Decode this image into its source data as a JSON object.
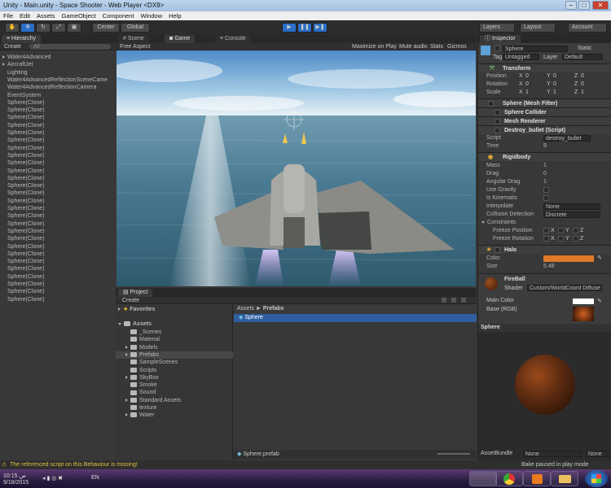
{
  "window": {
    "title": "Unity - Main.unity - Space Shooter - Web Player <DX9>",
    "min": "–",
    "max": "□",
    "close": "✕"
  },
  "menu": [
    "File",
    "Edit",
    "Assets",
    "GameObject",
    "Component",
    "Window",
    "Help"
  ],
  "toolbar": {
    "center": "Center",
    "global": "Global",
    "layers": "Layers",
    "layout": "Layout",
    "account": "Account"
  },
  "hierarchy": {
    "tab": "Hierarchy",
    "create": "Create",
    "search_placeholder": "All",
    "items": [
      "Water4Advanced",
      "AircraftJet",
      "Lighting",
      "Water4AdvancedReflectionSceneCame",
      "Water4AdvancedReflectionCamera",
      "EventSystem",
      "Sphere(Clone)",
      "Sphere(Clone)",
      "Sphere(Clone)",
      "Sphere(Clone)",
      "Sphere(Clone)",
      "Sphere(Clone)",
      "Sphere(Clone)",
      "Sphere(Clone)",
      "Sphere(Clone)",
      "Sphere(Clone)",
      "Sphere(Clone)",
      "Sphere(Clone)",
      "Sphere(Clone)",
      "Sphere(Clone)",
      "Sphere(Clone)",
      "Sphere(Clone)",
      "Sphere(Clone)",
      "Sphere(Clone)",
      "Sphere(Clone)",
      "Sphere(Clone)",
      "Sphere(Clone)",
      "Sphere(Clone)",
      "Sphere(Clone)",
      "Sphere(Clone)",
      "Sphere(Clone)",
      "Sphere(Clone)",
      "Sphere(Clone)"
    ]
  },
  "game": {
    "tabs": [
      "Scene",
      "Game",
      "Console"
    ],
    "aspect": "Free Aspect",
    "maximize": "Maximize on Play",
    "mute": "Mute audio",
    "stats": "Stats",
    "gizmos": "Gizmos"
  },
  "project": {
    "tab": "Project",
    "create": "Create",
    "favorites": "Favorites",
    "assets": "Assets",
    "folders": [
      "_Scenes",
      "Material",
      "Models",
      "Prefabs",
      "SampleScenes",
      "Scripts",
      "SkyBox",
      "Smoke",
      "Sound",
      "Standard Assets",
      "texture",
      "Water"
    ],
    "breadcrumb_root": "Assets",
    "breadcrumb_sep": "►",
    "breadcrumb_leaf": "Prefabs",
    "files": [
      "Sphere"
    ],
    "selected_path": "Sphere.prefab"
  },
  "inspector": {
    "tab": "Inspector",
    "name": "Sphere",
    "static": "Static",
    "tag_label": "Tag",
    "tag": "Untagged",
    "layer_label": "Layer",
    "layer": "Default",
    "transform": "Transform",
    "position": "Position",
    "rotation": "Rotation",
    "scale": "Scale",
    "pos": [
      "0",
      "0",
      "0"
    ],
    "rot": [
      "0",
      "0",
      "0"
    ],
    "scl": [
      "1",
      "1",
      "1"
    ],
    "mesh_filter": "Sphere (Mesh Filter)",
    "sphere_collider": "Sphere Collider",
    "mesh_renderer": "Mesh Renderer",
    "script_comp": "Destroy_bullet (Script)",
    "script_label": "Script",
    "script_value": "destroy_bullet",
    "time_label": "Time",
    "time_value": "5",
    "rigidbody": "Rigidbody",
    "mass_label": "Mass",
    "mass": "1",
    "drag_label": "Drag",
    "drag": "0",
    "adrag_label": "Angular Drag",
    "adrag": "1",
    "gravity": "Use Gravity",
    "kinematic": "Is Kinematic",
    "interp_label": "Interpolate",
    "interp": "None",
    "coll_label": "Collision Detection",
    "coll": "Discrete",
    "constraints": "Constraints",
    "fpos": "Freeze Position",
    "frot": "Freeze Rotation",
    "halo": "Halo",
    "color_label": "Color",
    "size_label": "Size",
    "size": "5.48",
    "halo_color": "#e07a2a",
    "material": "FireBall",
    "shader_label": "Shader",
    "shader": "Custom/WorldCoord Diffuse",
    "main_color": "Main Color",
    "base_rgb": "Base (RGB)",
    "preview": "Sphere",
    "assetbundle_label": "AssetBundle",
    "assetbundle": "None",
    "assetbundle2": "None"
  },
  "axes": [
    "X",
    "Y",
    "Z"
  ],
  "status": {
    "warning": "The referenced script on this Behaviour is missing!",
    "paused": "Bake paused in play mode"
  },
  "taskbar": {
    "lang": "EN",
    "time": "10:15 ص",
    "date": "9/18/2015"
  }
}
